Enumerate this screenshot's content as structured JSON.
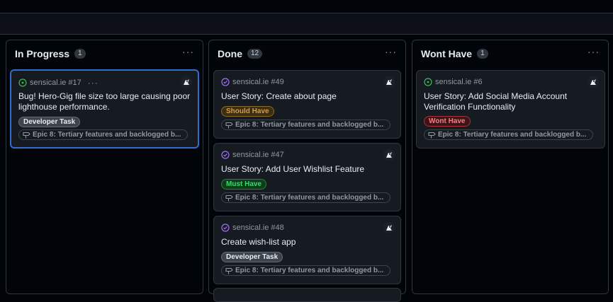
{
  "columns": [
    {
      "title": "In Progress",
      "count": "1",
      "menu": "···",
      "cards": [
        {
          "repo": "sensical.ie #17",
          "menu": "···",
          "title": "Bug! Hero-Gig file size too large causing poor lighthouse performance.",
          "label": "Developer Task",
          "epic": "Epic 8: Tertiary features and backlogged b..."
        }
      ]
    },
    {
      "title": "Done",
      "count": "12",
      "menu": "···",
      "cards": [
        {
          "repo": "sensical.ie #49",
          "title": "User Story: Create about page",
          "label": "Should Have",
          "epic": "Epic 8: Tertiary features and backlogged b..."
        },
        {
          "repo": "sensical.ie #47",
          "title": "User Story: Add User Wishlist Feature",
          "label": "Must Have",
          "epic": "Epic 8: Tertiary features and backlogged b..."
        },
        {
          "repo": "sensical.ie #48",
          "title": "Create wish-list app",
          "label": "Developer Task",
          "epic": "Epic 8: Tertiary features and backlogged b..."
        }
      ]
    },
    {
      "title": "Wont Have",
      "count": "1",
      "menu": "···",
      "cards": [
        {
          "repo": "sensical.ie #6",
          "title": "User Story: Add Social Media Account Verification Functionality",
          "label": "Wont Have",
          "epic": "Epic 8: Tertiary features and backlogged b..."
        }
      ]
    }
  ],
  "colors": {
    "open": "#3fb950",
    "closed": "#a371f7",
    "selected_border": "#316dca"
  }
}
